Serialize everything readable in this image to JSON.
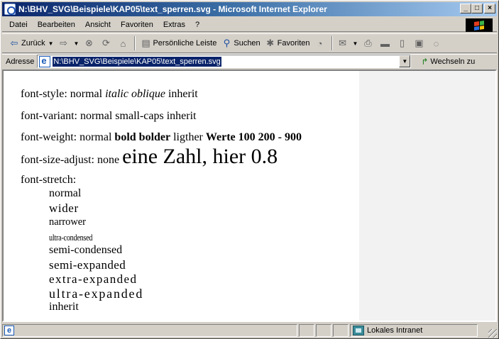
{
  "window": {
    "title": "N:\\BHV_SVG\\Beispiele\\KAP05\\text_sperren.svg - Microsoft Internet Explorer",
    "buttons": {
      "minimize": "_",
      "maximize": "□",
      "close": "×"
    }
  },
  "menu": [
    "Datei",
    "Bearbeiten",
    "Ansicht",
    "Favoriten",
    "Extras",
    "?"
  ],
  "toolbar": {
    "back_label": "Zurück",
    "personal_bar_label": "Persönliche Leiste",
    "search_label": "Suchen",
    "favorites_label": "Favoriten"
  },
  "address": {
    "label": "Adresse",
    "value": "N:\\BHV_SVG\\Beispiele\\KAP05\\text_sperren.svg",
    "go_label": "Wechseln zu"
  },
  "content": {
    "style_line": {
      "prefix": "font-style: normal ",
      "italic": "italic",
      "oblique": "oblique",
      "suffix": " inherit"
    },
    "variant_line": "font-variant: normal small-caps inherit",
    "weight_line": {
      "prefix": "font-weight: normal ",
      "bold": "bold bolder",
      "middle": " ligther ",
      "values": "Werte 100 200 - 900"
    },
    "size_adjust_line": {
      "prefix": "font-size-adjust: none ",
      "big": "eine Zahl, hier 0.8"
    },
    "stretch_label": "font-stretch:",
    "stretch_values": [
      "normal",
      "wider",
      "narrower",
      "ultra-condensed",
      "semi-condensed",
      "semi-expanded",
      "extra-expanded",
      "ultra-expanded",
      "inherit"
    ]
  },
  "status": {
    "zone_label": "Lokales Intranet"
  }
}
